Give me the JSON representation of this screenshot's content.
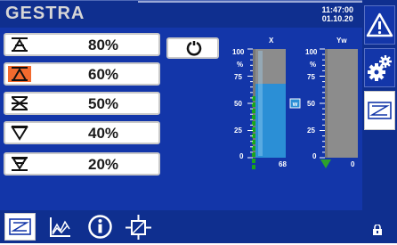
{
  "header": {
    "brand": "GESTRA",
    "time": "11:47:00",
    "date": "01.10.20"
  },
  "valve_rows": [
    {
      "label": "80%",
      "icon": "valve-symbol-icon",
      "active": false
    },
    {
      "label": "60%",
      "icon": "valve-symbol-orange-icon",
      "active": true
    },
    {
      "label": "50%",
      "icon": "valve-crossed-icon",
      "active": false
    },
    {
      "label": "40%",
      "icon": "valve-down-icon",
      "active": false
    },
    {
      "label": "20%",
      "icon": "valve-down-bar-icon",
      "active": false
    }
  ],
  "gauges": {
    "x": {
      "label": "X",
      "unit": "%",
      "ticks": [
        "100",
        "75",
        "50",
        "25",
        "0"
      ],
      "value": 68,
      "value_text": "68",
      "marker": "w"
    },
    "yw": {
      "label": "Yw",
      "unit": "%",
      "ticks": [
        "100",
        "75",
        "50",
        "25",
        "0"
      ],
      "value": 0,
      "value_text": "0"
    }
  },
  "right_buttons": [
    "warning-icon",
    "settings-gears-icon",
    "valve-screen-icon"
  ],
  "bottom_buttons": [
    "valve-screen-icon",
    "trend-chart-icon",
    "info-icon",
    "valve-actuator-icon"
  ],
  "colors": {
    "header_bg": "#0f2f8f",
    "main_bg": "#1336a9",
    "gauge_fill": "#2b8fd6",
    "active_row": "#f26a2e",
    "indicator_green": "#1ba51b"
  }
}
